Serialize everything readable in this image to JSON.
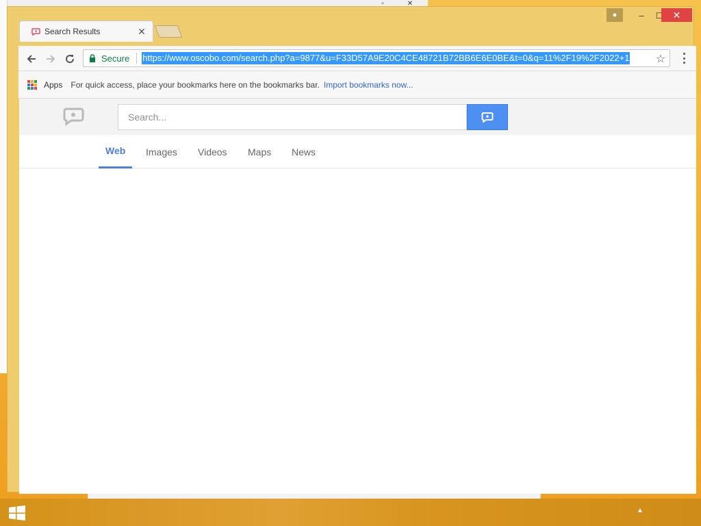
{
  "browser": {
    "tab_title": "Search Results",
    "secure_label": "Secure",
    "url": "https://www.oscobo.com/search.php?a=9877&u=F33D57A9E20C4CE48721B72BB6E6E0BE&t=0&q=11%2F19%2F2022+1",
    "bookmarks": {
      "apps_label": "Apps",
      "hint_text": "For quick access, place your bookmarks here on the bookmarks bar.",
      "import_link": "Import bookmarks now..."
    },
    "icons": {
      "back": "back-arrow-icon",
      "forward": "forward-arrow-icon",
      "reload": "reload-icon",
      "lock": "lock-icon",
      "star": "star-icon",
      "menu": "menu-dots-icon",
      "tab_close": "close-icon"
    }
  },
  "page": {
    "search_placeholder": "Search...",
    "search_value": "",
    "tabs": [
      {
        "label": "Web",
        "active": true
      },
      {
        "label": "Images",
        "active": false
      },
      {
        "label": "Videos",
        "active": false
      },
      {
        "label": "Maps",
        "active": false
      },
      {
        "label": "News",
        "active": false
      }
    ],
    "colors": {
      "accent": "#4a80d6",
      "search_button": "#4e8ff2",
      "secure_green": "#0b8043",
      "url_highlight": "#3399ff"
    }
  }
}
